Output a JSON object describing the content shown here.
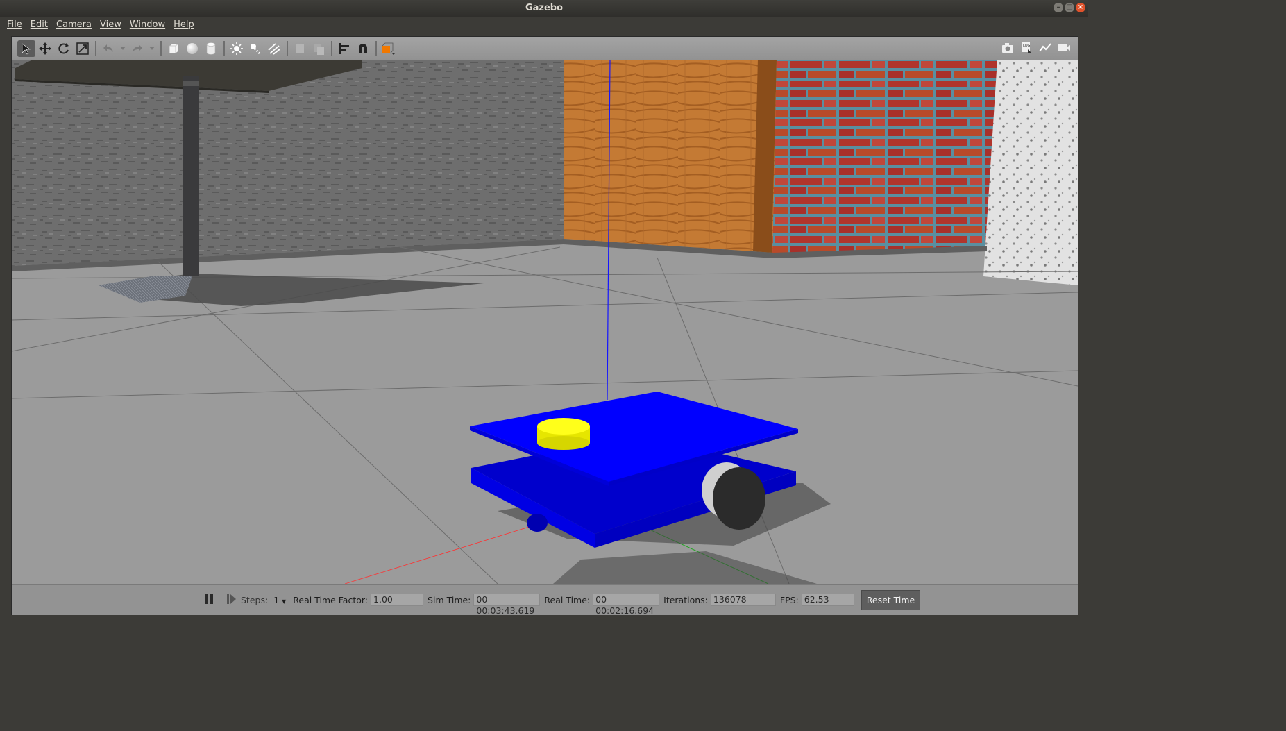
{
  "window": {
    "title": "Gazebo"
  },
  "menu": [
    "File",
    "Edit",
    "Camera",
    "View",
    "Window",
    "Help"
  ],
  "toolbar": {
    "left_icons": [
      "select-arrow-icon",
      "translate-icon",
      "rotate-icon",
      "scale-icon",
      "undo-icon",
      "undo-dropdown-icon",
      "redo-icon",
      "redo-dropdown-icon",
      "box-icon",
      "sphere-icon",
      "cylinder-icon",
      "point-light-icon",
      "spot-light-icon",
      "directional-light-icon",
      "copy-icon",
      "paste-icon",
      "align-icon",
      "snap-icon",
      "view-angle-icon"
    ],
    "right_icons": [
      "screenshot-icon",
      "log-icon",
      "plot-icon",
      "record-video-icon"
    ]
  },
  "status": {
    "steps_label": "Steps:",
    "steps_value": "1",
    "rtf_label": "Real Time Factor:",
    "rtf_value": "1.00",
    "sim_label": "Sim Time:",
    "sim_value": "00 00:03:43.619",
    "real_label": "Real Time:",
    "real_value": "00 00:02:16.694",
    "iter_label": "Iterations:",
    "iter_value": "136078",
    "fps_label": "FPS:",
    "fps_value": "62.53",
    "reset_label": "Reset Time"
  },
  "colors": {
    "robot_body": "#0000f0",
    "sensor": "#f2f200",
    "floor": "#9c9c9c",
    "toolbar": "#9a9a9a"
  }
}
